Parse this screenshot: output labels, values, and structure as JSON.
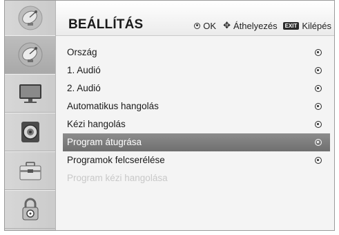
{
  "header": {
    "title": "BEÁLLÍTÁS",
    "hint_ok": "OK",
    "hint_move": "Áthelyezés",
    "exit_badge": "EXIT",
    "hint_exit": "Kilépés"
  },
  "sidebar": {
    "top_icon": "satellite-dish-icon",
    "items": [
      {
        "icon": "satellite-dish-icon",
        "active": true
      },
      {
        "icon": "tv-monitor-icon",
        "active": false
      },
      {
        "icon": "speaker-icon",
        "active": false
      },
      {
        "icon": "toolbox-icon",
        "active": false
      },
      {
        "icon": "padlock-icon",
        "active": false
      }
    ]
  },
  "menu": {
    "items": [
      {
        "label": "Ország",
        "state": "normal"
      },
      {
        "label": "1. Audió",
        "state": "normal"
      },
      {
        "label": "2. Audió",
        "state": "normal"
      },
      {
        "label": "Automatikus hangolás",
        "state": "normal"
      },
      {
        "label": "Kézi hangolás",
        "state": "normal"
      },
      {
        "label": "Program átugrása",
        "state": "selected"
      },
      {
        "label": "Programok felcserélése",
        "state": "normal"
      },
      {
        "label": "Program kézi hangolása",
        "state": "disabled"
      }
    ]
  },
  "colors": {
    "selected_row": "#7d7d7d",
    "disabled_text": "#c8c8c8",
    "sidebar_bg": "#d1d1d1"
  }
}
